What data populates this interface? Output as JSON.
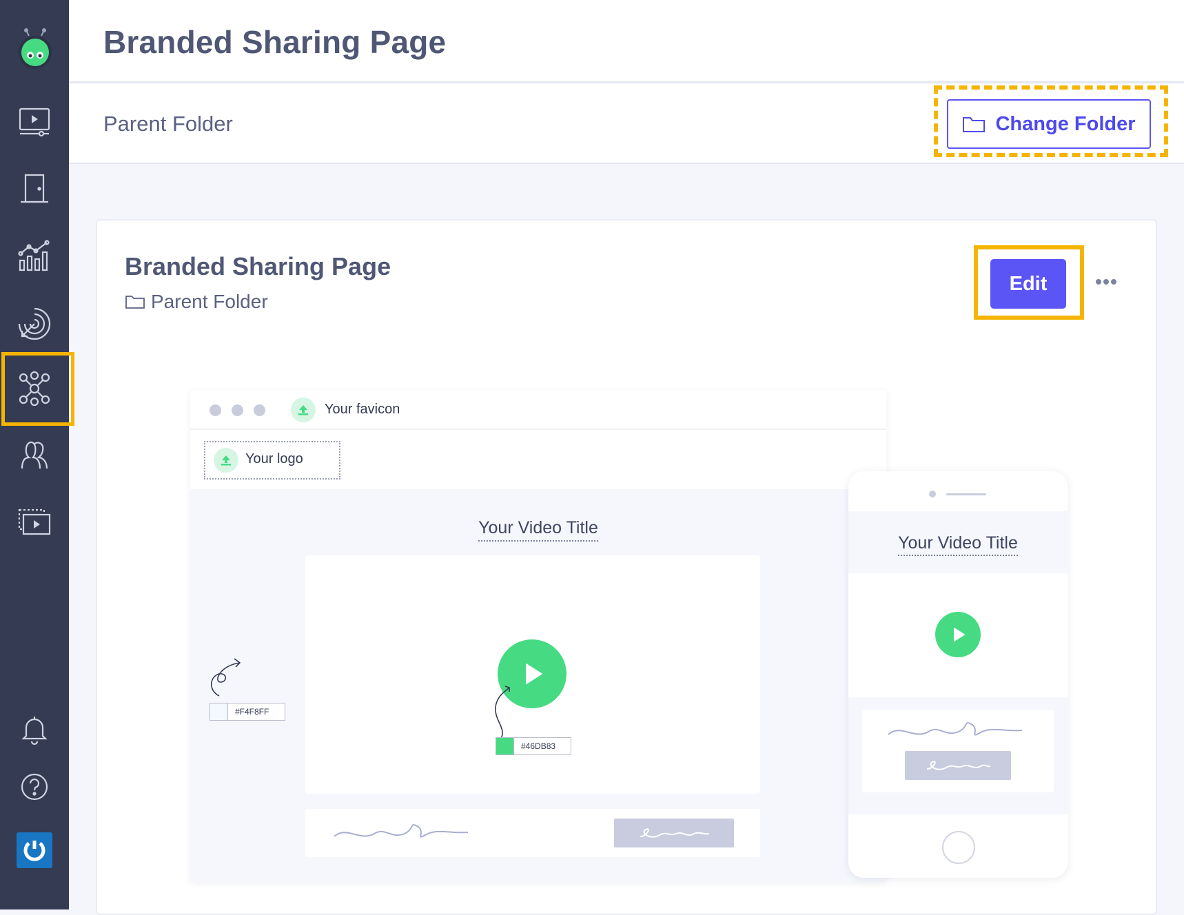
{
  "header": {
    "title": "Branded Sharing Page"
  },
  "folder_bar": {
    "label": "Parent Folder",
    "change_folder_label": "Change Folder"
  },
  "card": {
    "title": "Branded Sharing Page",
    "folder": "Parent Folder",
    "edit_label": "Edit"
  },
  "preview": {
    "favicon_label": "Your favicon",
    "logo_label": "Your logo",
    "video_title": "Your Video Title",
    "background_color": "#F4F8FF",
    "accent_color": "#46DB83",
    "mobile_video_title": "Your Video Title"
  },
  "sidebar": {
    "items": [
      {
        "icon": "videos-icon"
      },
      {
        "icon": "door-icon"
      },
      {
        "icon": "analytics-icon"
      },
      {
        "icon": "target-icon"
      },
      {
        "icon": "integrations-icon",
        "highlighted": true
      },
      {
        "icon": "team-icon"
      },
      {
        "icon": "slideshow-icon"
      },
      {
        "icon": "bell-icon"
      },
      {
        "icon": "help-icon"
      }
    ]
  },
  "colors": {
    "sidebar": "#343b52",
    "primary": "#5b55f5",
    "highlight": "#f5b400",
    "green": "#46db83"
  }
}
